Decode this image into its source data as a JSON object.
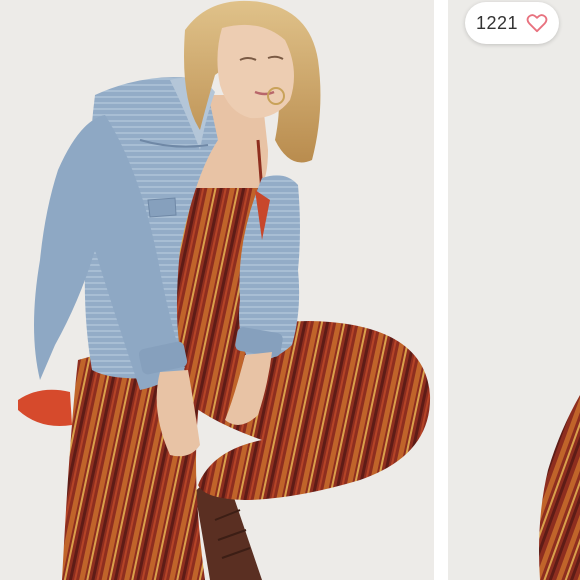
{
  "listing": {
    "like_count": "1221",
    "like_icon": "heart-outline-icon",
    "accent_color": "#e8727f",
    "images": [
      {
        "subject": "model-in-denim-jacket-and-striped-jumpsuit"
      },
      {
        "subject": "next-photo-preview"
      }
    ]
  }
}
